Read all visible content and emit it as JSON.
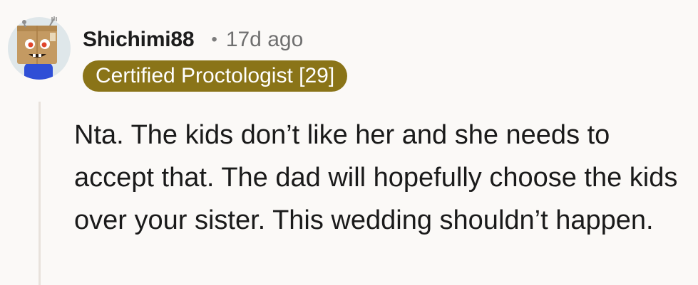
{
  "comment": {
    "author": "Shichimi88",
    "separator": "•",
    "timestamp": "17d ago",
    "flair": "Certified Proctologist [29]",
    "body": "Nta. The kids don’t like her and she needs to accept that. The dad will hopefully choose the kids over your sister. This wedding shouldn’t happen."
  },
  "avatar": {
    "icon": "snoo-box-head-avatar-icon"
  },
  "colors": {
    "background": "#fbf9f7",
    "flair_background": "#8a7418",
    "flair_text": "#ffffff",
    "thread_line": "#e8e2dc",
    "timestamp": "#6f6f6f"
  }
}
